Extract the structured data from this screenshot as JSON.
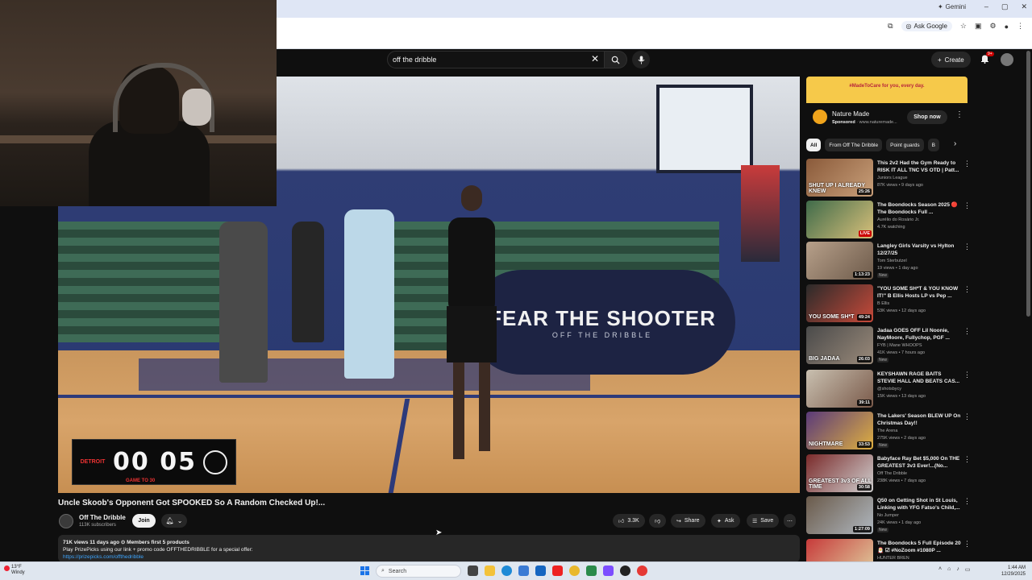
{
  "browser": {
    "gemini_label": "Gemini",
    "ask_google_label": "Ask Google",
    "window_controls": [
      "–",
      "▢",
      "✕"
    ]
  },
  "youtube": {
    "search_query": "off the dribble",
    "create_label": "Create",
    "notifications_badge": "9+"
  },
  "video": {
    "banner_line1": "FEAR THE SHOOTER",
    "banner_line2": "OFF THE DRIBBLE",
    "scoreboard_logo": "DETROIT",
    "scoreboard_digits": "00 05",
    "scoreboard_sub": "GAME TO 30",
    "title": "Uncle Skoob's Opponent Got SPOOKED So A Random Checked Up!...",
    "channel_name": "Off The Dribble",
    "channel_subs": "113K subscribers",
    "join_label": "Join",
    "likes": "3.3K",
    "share_label": "Share",
    "ask_label": "Ask",
    "save_label": "Save",
    "desc_stats": "71K views  11 days ago  ⊙ Members first  5 products",
    "desc_line2": "Play PrizePicks using our link + promo code OFFTHEDRIBBLE for a special offer:",
    "desc_link": "https://prizepicks.com/offthedribble"
  },
  "ad": {
    "banner_text": "#MadeToCare  for you, every day.",
    "advertiser": "Nature Made",
    "sponsored": "Sponsored",
    "domain": "www.naturemade...",
    "shop_label": "Shop now"
  },
  "chips": [
    "All",
    "From Off The Dribble",
    "Point guards",
    "B"
  ],
  "recommendations": [
    {
      "title": "This 2v2 Had the Gym Ready to RISK IT ALL TNC VS OTD | Patt...",
      "channel": "Juniors League",
      "views": "87K views • 9 days ago",
      "duration": "25:26",
      "thumb_text": "SHUT UP I ALREADY KNEW",
      "badge": ""
    },
    {
      "title": "The Boondocks Season 2025 🔴 The Boondocks Full ...",
      "channel": "Aurélio do Rosário Jr.",
      "views": "4.7K watching",
      "duration": "LIVE",
      "thumb_text": "",
      "badge": ""
    },
    {
      "title": "Langley Girls Varsity vs Hylton 12/27/25",
      "channel": "Tom Sterbutzel",
      "views": "19 views • 1 day ago",
      "duration": "1:13:23",
      "thumb_text": "",
      "badge": "New"
    },
    {
      "title": "\"YOU SOME SH*T & YOU KNOW IT!\" B Ellis Hosts LP vs Pep ...",
      "channel": "B Ellis",
      "views": "53K views • 12 days ago",
      "duration": "49:24",
      "thumb_text": "YOU SOME SH*T",
      "badge": ""
    },
    {
      "title": "Jadaa GOES OFF Lil Noonie, NayMoore, Fullychop, PGF ...",
      "channel": "FYB | Mane WHOOPS",
      "views": "41K views • 7 hours ago",
      "duration": "26:03",
      "thumb_text": "BIG JADAA",
      "badge": "New"
    },
    {
      "title": "KEYSHAWN RAGE BAITS STEVIE HALL AND BEATS CAS...",
      "channel": "@shotsbycy",
      "views": "15K views • 13 days ago",
      "duration": "39:11",
      "thumb_text": "",
      "badge": ""
    },
    {
      "title": "The Lakers' Season BLEW UP On Christmas Day!!",
      "channel": "The Arena",
      "views": "275K views • 2 days ago",
      "duration": "33:53",
      "thumb_text": "NIGHTMARE",
      "badge": "New"
    },
    {
      "title": "Babyface Ray Bet $5,000 On THE GREATEST 3v3 Ever!...(No...",
      "channel": "Off The Dribble",
      "views": "238K views • 7 days ago",
      "duration": "30:58",
      "thumb_text": "GREATEST 3v3 OF ALL TIME",
      "badge": ""
    },
    {
      "title": "Q50 on Getting Shot in St Louis, Linking with YFG Fatso's Child,...",
      "channel": "No Jumper",
      "views": "24K views • 1 day ago",
      "duration": "1:27:09",
      "thumb_text": "",
      "badge": "New"
    },
    {
      "title": "The Boondocks  5  Full Episode 20 🎅 ☑ #NoZoom #1080P ...",
      "channel": "HUNTER BREN",
      "views": "",
      "duration": "",
      "thumb_text": "",
      "badge": ""
    }
  ],
  "taskbar": {
    "weather_temp": "13°F",
    "weather_desc": "Windy",
    "search_placeholder": "Search",
    "time": "1:44 AM",
    "date": "12/29/2025"
  },
  "colors": {
    "yt_bg": "#0f0f0f",
    "accent_red": "#cc0000",
    "link_blue": "#3ea6ff"
  }
}
